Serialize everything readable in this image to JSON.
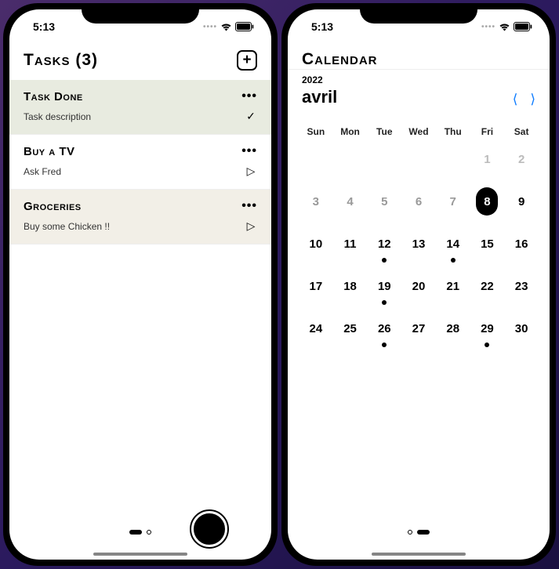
{
  "status": {
    "time": "5:13"
  },
  "tasks": {
    "title": "Tasks (3)",
    "items": [
      {
        "title": "Task Done",
        "desc": "Task description",
        "done": true
      },
      {
        "title": "Buy a TV",
        "desc": "Ask Fred",
        "done": false
      },
      {
        "title": "Groceries",
        "desc": "Buy some Chicken !!",
        "done": false
      }
    ]
  },
  "calendar": {
    "title": "Calendar",
    "year": "2022",
    "month": "avril",
    "dow": [
      "Sun",
      "Mon",
      "Tue",
      "Wed",
      "Thu",
      "Fri",
      "Sat"
    ],
    "days": [
      {
        "n": "",
        "state": "blank"
      },
      {
        "n": "",
        "state": "blank"
      },
      {
        "n": "",
        "state": "blank"
      },
      {
        "n": "",
        "state": "blank"
      },
      {
        "n": "",
        "state": "blank"
      },
      {
        "n": "1",
        "state": "muted"
      },
      {
        "n": "2",
        "state": "muted"
      },
      {
        "n": "3",
        "state": "light"
      },
      {
        "n": "4",
        "state": "light"
      },
      {
        "n": "5",
        "state": "light"
      },
      {
        "n": "6",
        "state": "light"
      },
      {
        "n": "7",
        "state": "light"
      },
      {
        "n": "8",
        "state": "selected"
      },
      {
        "n": "9",
        "state": "normal"
      },
      {
        "n": "10",
        "state": "normal"
      },
      {
        "n": "11",
        "state": "normal"
      },
      {
        "n": "12",
        "state": "normal",
        "event": true
      },
      {
        "n": "13",
        "state": "normal"
      },
      {
        "n": "14",
        "state": "normal",
        "event": true
      },
      {
        "n": "15",
        "state": "normal"
      },
      {
        "n": "16",
        "state": "normal"
      },
      {
        "n": "17",
        "state": "normal"
      },
      {
        "n": "18",
        "state": "normal"
      },
      {
        "n": "19",
        "state": "normal",
        "event": true
      },
      {
        "n": "20",
        "state": "normal"
      },
      {
        "n": "21",
        "state": "normal"
      },
      {
        "n": "22",
        "state": "normal"
      },
      {
        "n": "23",
        "state": "normal"
      },
      {
        "n": "24",
        "state": "normal"
      },
      {
        "n": "25",
        "state": "normal"
      },
      {
        "n": "26",
        "state": "normal",
        "event": true
      },
      {
        "n": "27",
        "state": "normal"
      },
      {
        "n": "28",
        "state": "normal"
      },
      {
        "n": "29",
        "state": "normal",
        "event": true
      },
      {
        "n": "30",
        "state": "normal"
      }
    ]
  }
}
